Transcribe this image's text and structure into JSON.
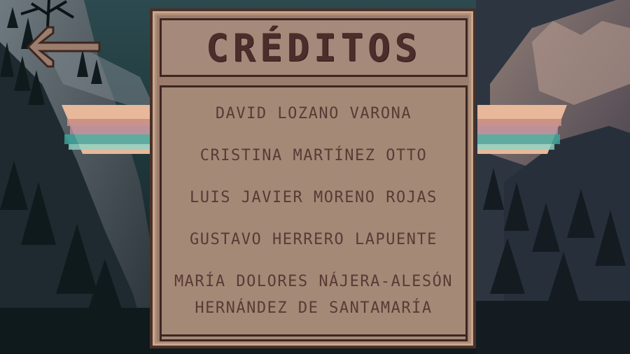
{
  "screen": {
    "title": "CRÉDITOS"
  },
  "credits": [
    {
      "lines": [
        "DAVID LOZANO VARONA"
      ]
    },
    {
      "lines": [
        "CRISTINA MARTÍNEZ OTTO"
      ]
    },
    {
      "lines": [
        "LUIS JAVIER MORENO ROJAS"
      ]
    },
    {
      "lines": [
        "GUSTAVO HERRERO LAPUENTE"
      ]
    },
    {
      "lines": [
        "MARÍA DOLORES NÁJERA-ALESÓN",
        "HERNÁNDEZ DE SANTAMARÍA"
      ]
    }
  ],
  "icons": {
    "back": "arrow-left-icon"
  },
  "colors": {
    "panel": "#9a7d6c",
    "panel_border": "#3e2620",
    "text": "#5a3a35",
    "title": "#4b2e2b"
  }
}
